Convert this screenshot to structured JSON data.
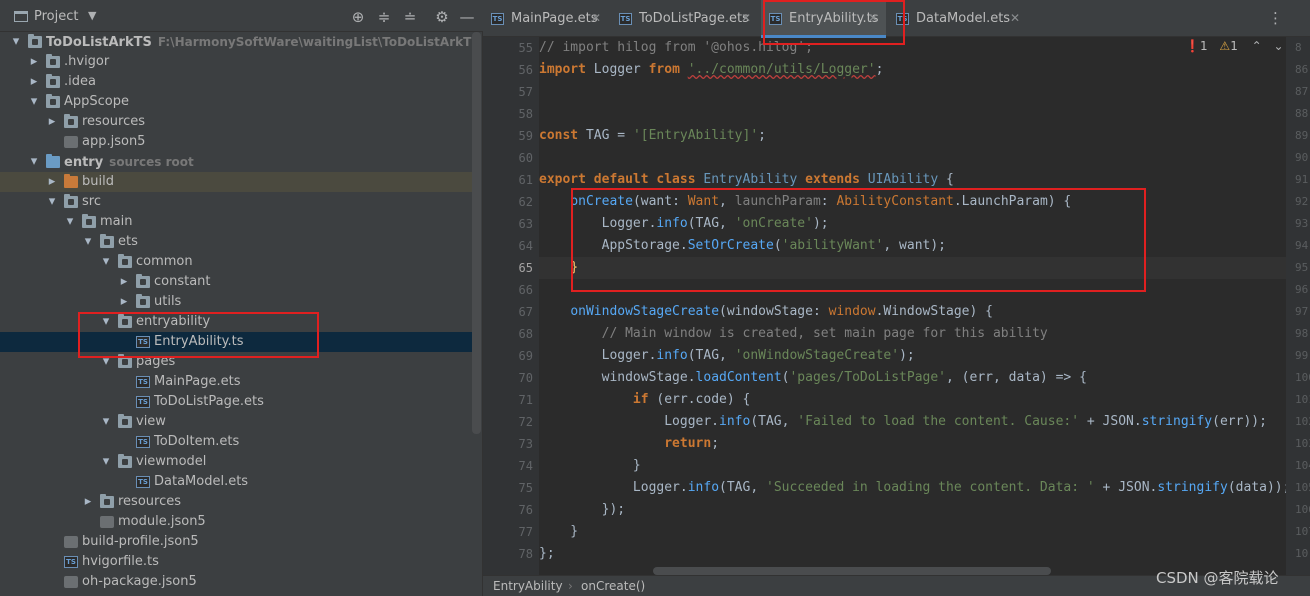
{
  "project_panel": {
    "title": "Project",
    "tree": [
      {
        "label": "ToDoListArkTS",
        "sub": "F:\\HarmonySoftWare\\waitingList\\ToDoListArkTS",
        "depth": 0,
        "arrow": "open",
        "icon": "folder",
        "bold": true
      },
      {
        "label": ".hvigor",
        "depth": 1,
        "arrow": "closed",
        "icon": "folder"
      },
      {
        "label": ".idea",
        "depth": 1,
        "arrow": "closed",
        "icon": "folder"
      },
      {
        "label": "AppScope",
        "depth": 1,
        "arrow": "open",
        "icon": "folder"
      },
      {
        "label": "resources",
        "depth": 2,
        "arrow": "closed",
        "icon": "folder"
      },
      {
        "label": "app.json5",
        "depth": 2,
        "arrow": "none",
        "icon": "json"
      },
      {
        "label": "entry",
        "sub": "sources root",
        "depth": 1,
        "arrow": "open",
        "icon": "folder-blue",
        "bold": true
      },
      {
        "label": "build",
        "depth": 2,
        "arrow": "closed",
        "icon": "folder-orange",
        "highlight": "folder"
      },
      {
        "label": "src",
        "depth": 2,
        "arrow": "open",
        "icon": "folder"
      },
      {
        "label": "main",
        "depth": 3,
        "arrow": "open",
        "icon": "folder"
      },
      {
        "label": "ets",
        "depth": 4,
        "arrow": "open",
        "icon": "folder"
      },
      {
        "label": "common",
        "depth": 5,
        "arrow": "open",
        "icon": "folder"
      },
      {
        "label": "constant",
        "depth": 6,
        "arrow": "closed",
        "icon": "folder"
      },
      {
        "label": "utils",
        "depth": 6,
        "arrow": "closed",
        "icon": "folder"
      },
      {
        "label": "entryability",
        "depth": 5,
        "arrow": "open",
        "icon": "folder"
      },
      {
        "label": "EntryAbility.ts",
        "depth": 6,
        "arrow": "none",
        "icon": "ts",
        "highlight": "selected"
      },
      {
        "label": "pages",
        "depth": 5,
        "arrow": "open",
        "icon": "folder"
      },
      {
        "label": "MainPage.ets",
        "depth": 6,
        "arrow": "none",
        "icon": "ts"
      },
      {
        "label": "ToDoListPage.ets",
        "depth": 6,
        "arrow": "none",
        "icon": "ts"
      },
      {
        "label": "view",
        "depth": 5,
        "arrow": "open",
        "icon": "folder"
      },
      {
        "label": "ToDoItem.ets",
        "depth": 6,
        "arrow": "none",
        "icon": "ts"
      },
      {
        "label": "viewmodel",
        "depth": 5,
        "arrow": "open",
        "icon": "folder"
      },
      {
        "label": "DataModel.ets",
        "depth": 6,
        "arrow": "none",
        "icon": "ts"
      },
      {
        "label": "resources",
        "depth": 4,
        "arrow": "closed",
        "icon": "folder"
      },
      {
        "label": "module.json5",
        "depth": 4,
        "arrow": "none",
        "icon": "json"
      },
      {
        "label": "build-profile.json5",
        "depth": 2,
        "arrow": "none",
        "icon": "json"
      },
      {
        "label": "hvigorfile.ts",
        "depth": 2,
        "arrow": "none",
        "icon": "ts"
      },
      {
        "label": "oh-package.json5",
        "depth": 2,
        "arrow": "none",
        "icon": "json"
      }
    ]
  },
  "tabs": [
    {
      "label": "MainPage.ets",
      "active": false
    },
    {
      "label": "ToDoListPage.ets",
      "active": false
    },
    {
      "label": "EntryAbility.ts",
      "active": true
    },
    {
      "label": "DataModel.ets",
      "active": false
    }
  ],
  "inspections": {
    "errors": "1",
    "warnings": "1"
  },
  "line_numbers": [
    "55",
    "56",
    "57",
    "58",
    "59",
    "60",
    "61",
    "62",
    "63",
    "64",
    "65",
    "66",
    "67",
    "68",
    "69",
    "70",
    "71",
    "72",
    "73",
    "74",
    "75",
    "76",
    "77",
    "78"
  ],
  "current_line": "65",
  "right_line_numbers": [
    "8",
    "86",
    "87",
    "88",
    "89",
    "90",
    "91",
    "92",
    "93",
    "94",
    "95",
    "96",
    "97",
    "98",
    "99",
    "100",
    "101",
    "102",
    "103",
    "104",
    "105",
    "106",
    "107",
    "10"
  ],
  "breadcrumb": {
    "class": "EntryAbility",
    "method": "onCreate()"
  },
  "watermark": "CSDN @客院载论"
}
